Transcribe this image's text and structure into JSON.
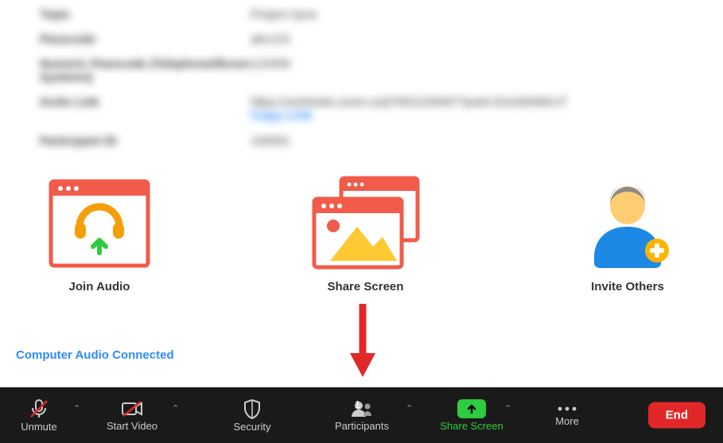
{
  "info": {
    "rows": [
      {
        "label": "Topic",
        "value": "Project Sync"
      },
      {
        "label": "Passcode",
        "value": "abc123"
      },
      {
        "label": "Numeric Passcode (Telephone/Room Systems)",
        "value": "123456"
      },
      {
        "label": "Invite Link",
        "value": "https://us04web.zoom.us/j/7831234567?pwd=ZGxhbW8rUT",
        "link": "Copy Link"
      },
      {
        "label": "Participant ID",
        "value": "100001"
      }
    ]
  },
  "actions": {
    "join_audio": "Join Audio",
    "share_screen": "Share Screen",
    "invite_others": "Invite Others"
  },
  "audio_status": "Computer Audio Connected",
  "toolbar": {
    "unmute": "Unmute",
    "start_video": "Start Video",
    "security": "Security",
    "participants": "Participants",
    "participants_count": "1",
    "share_screen": "Share Screen",
    "more": "More",
    "end": "End"
  },
  "colors": {
    "accent": "#2d8cff",
    "danger": "#e02828",
    "green": "#2ecc40",
    "tile_red": "#f15b4a",
    "orange": "#f59e0b"
  }
}
